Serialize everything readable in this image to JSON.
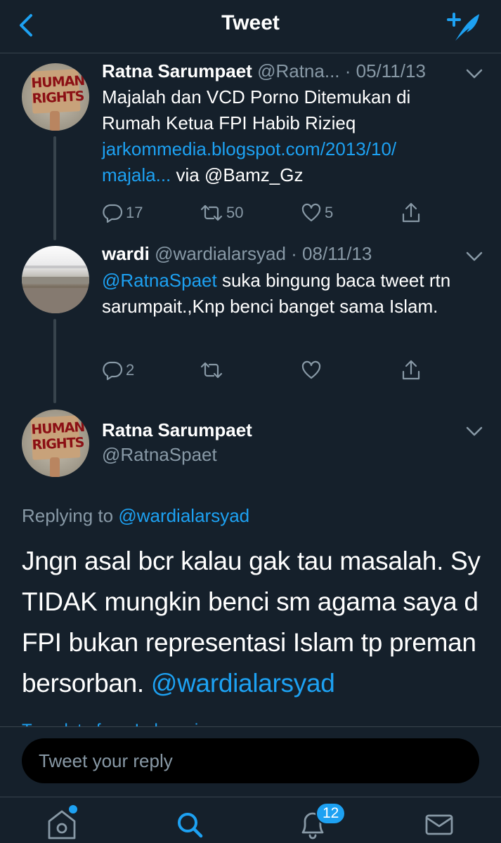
{
  "header": {
    "title": "Tweet"
  },
  "thread": [
    {
      "name": "Ratna Sarumpaet",
      "handle_date": "@Ratna... · 05/11/13",
      "body_lines": [
        "Majalah dan VCD Porno Ditemukan di",
        "Rumah Ketua FPI Habib Rizieq"
      ],
      "link_line1": "jarkommedia.blogspot.com/2013/10/",
      "link_line2": "majala...",
      "via": " via @Bamz_Gz",
      "replies": "17",
      "retweets": "50",
      "likes": "5"
    },
    {
      "name": "wardi",
      "handle_date": "@wardialarsyad · 08/11/13",
      "mention": "@RatnaSpaet",
      "body_rest": " suka bingung baca tweet rtn sarumpait.,Knp benci banget sama Islam.",
      "replies": "2"
    }
  ],
  "main_tweet": {
    "name": "Ratna Sarumpaet",
    "handle": "@RatnaSpaet",
    "replying_label": "Replying to ",
    "replying_to": "@wardialarsyad",
    "text": "Jngn asal bcr kalau gak tau masalah. Sy TIDAK mungkin benci sm agama saya d FPI bukan representasi Islam tp preman bersorban. ",
    "mention": "@wardialarsyad",
    "translate": "Translate from Indonesian"
  },
  "avatar_sign": {
    "line1": "HUMAN",
    "line2": "RIGHTS"
  },
  "reply_bar": {
    "placeholder": "Tweet your reply"
  },
  "tabbar": {
    "notifications_badge": "12"
  },
  "colors": {
    "background": "#15202b",
    "accent": "#1da1f2",
    "muted": "#8899a6",
    "border": "#38444d"
  },
  "icons": [
    "back-arrow-icon",
    "compose-tweet-icon",
    "chevron-down-icon",
    "reply-icon",
    "retweet-icon",
    "like-icon",
    "share-icon",
    "home-icon",
    "search-icon",
    "notifications-icon",
    "messages-icon"
  ]
}
